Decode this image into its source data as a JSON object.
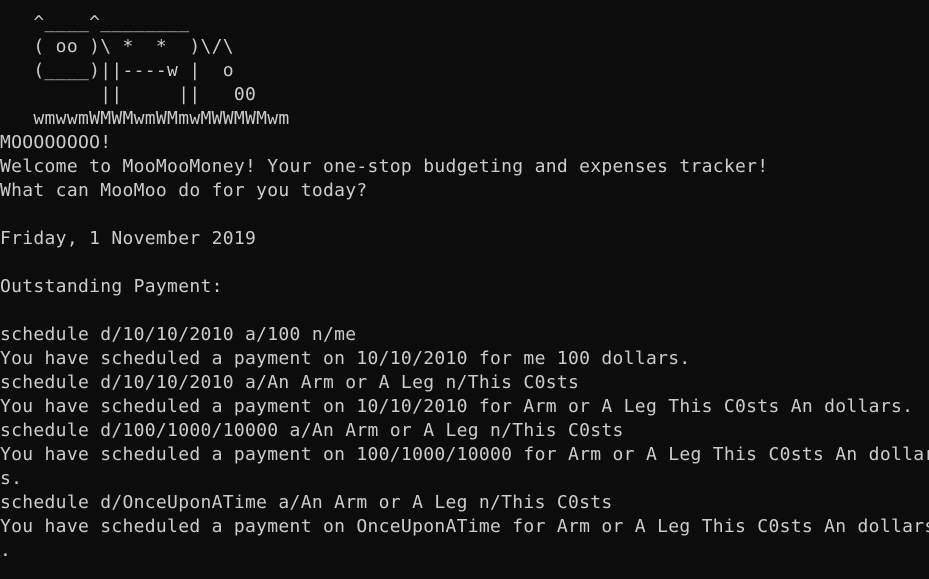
{
  "terminal": {
    "lines": [
      "   ^____^________",
      "   ( oo )\\ *  *  )\\/\\",
      "   (____)||----w |  o",
      "         ||     ||   00",
      "   wmwwmWMWMwmWMmwMWWMWMwm",
      "MOOOOOOOO!",
      "Welcome to MooMooMoney! Your one-stop budgeting and expenses tracker!",
      "What can MooMoo do for you today?",
      "",
      "Friday, 1 November 2019",
      "",
      "Outstanding Payment:",
      "",
      "schedule d/10/10/2010 a/100 n/me",
      "You have scheduled a payment on 10/10/2010 for me 100 dollars.",
      "schedule d/10/10/2010 a/An Arm or A Leg n/This C0sts",
      "You have scheduled a payment on 10/10/2010 for Arm or A Leg This C0sts An dollars.",
      "schedule d/100/1000/10000 a/An Arm or A Leg n/This C0sts",
      "You have scheduled a payment on 100/1000/10000 for Arm or A Leg This C0sts An dollar",
      "s.",
      "schedule d/OnceUponATime a/An Arm or A Leg n/This C0sts",
      "You have scheduled a payment on OnceUponATime for Arm or A Leg This C0sts An dollars",
      "."
    ]
  }
}
